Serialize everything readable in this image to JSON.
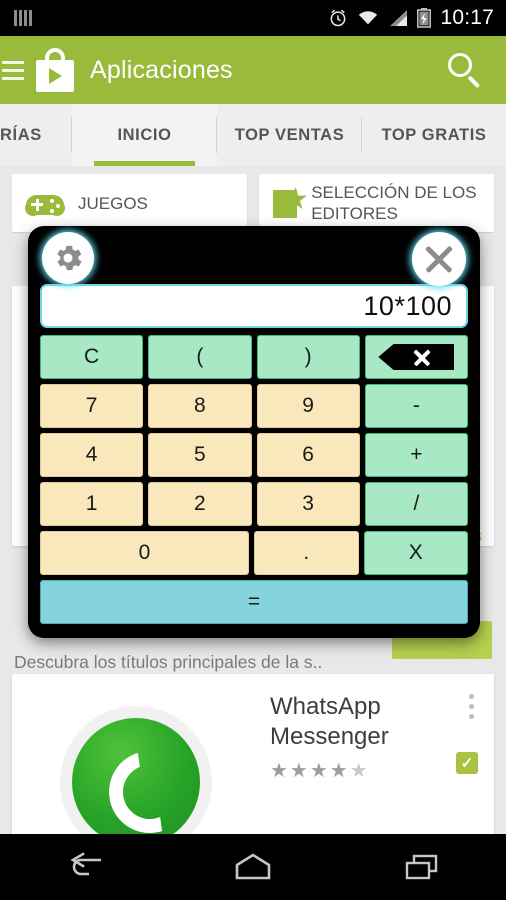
{
  "status_bar": {
    "clock": "10:17",
    "icons": [
      "sim-signal-bars-icon",
      "alarm-icon",
      "wifi-icon",
      "cell-signal-icon",
      "battery-charging-icon"
    ]
  },
  "action_bar": {
    "menu_icon": "hamburger-menu-icon",
    "logo_icon": "google-play-bag-icon",
    "title": "Aplicaciones",
    "search_icon": "search-icon",
    "bg_color": "#9aba3c"
  },
  "tabs": [
    {
      "label": "RÍAS",
      "active": false
    },
    {
      "label": "INICIO",
      "active": true
    },
    {
      "label": "TOP VENTAS",
      "active": false
    },
    {
      "label": "TOP GRATIS",
      "active": false
    }
  ],
  "content": {
    "categories": [
      {
        "label": "JUEGOS",
        "icon": "gamepad-icon"
      },
      {
        "label": "SELECCIÓN DE LOS EDITORES",
        "icon": "editors-choice-star-icon"
      }
    ],
    "blurb": "Descubra los títulos principales de la s..",
    "ghost_text_s": "s",
    "app_card": {
      "title": "WhatsApp Messenger",
      "icon": "whatsapp-phone-icon",
      "rating_filled": 4,
      "rating_total": 5,
      "overflow_icon": "more-vertical-icon",
      "installed_icon": "installed-check-badge-icon",
      "installed_glyph": "✓"
    }
  },
  "calculator": {
    "settings_icon": "gear-icon",
    "close_icon": "close-icon",
    "display_value": "10*100",
    "rows": [
      [
        {
          "label": "C",
          "type": "op",
          "name": "clear-key"
        },
        {
          "label": "(",
          "type": "op",
          "name": "open-paren-key"
        },
        {
          "label": ")",
          "type": "op",
          "name": "close-paren-key"
        },
        {
          "label": "",
          "type": "op",
          "name": "backspace-key",
          "icon": "backspace-icon"
        }
      ],
      [
        {
          "label": "7",
          "type": "num",
          "name": "digit-7-key"
        },
        {
          "label": "8",
          "type": "num",
          "name": "digit-8-key"
        },
        {
          "label": "9",
          "type": "num",
          "name": "digit-9-key"
        },
        {
          "label": "-",
          "type": "op",
          "name": "minus-key"
        }
      ],
      [
        {
          "label": "4",
          "type": "num",
          "name": "digit-4-key"
        },
        {
          "label": "5",
          "type": "num",
          "name": "digit-5-key"
        },
        {
          "label": "6",
          "type": "num",
          "name": "digit-6-key"
        },
        {
          "label": "+",
          "type": "op",
          "name": "plus-key"
        }
      ],
      [
        {
          "label": "1",
          "type": "num",
          "name": "digit-1-key"
        },
        {
          "label": "2",
          "type": "num",
          "name": "digit-2-key"
        },
        {
          "label": "3",
          "type": "num",
          "name": "digit-3-key"
        },
        {
          "label": "/",
          "type": "op",
          "name": "divide-key"
        }
      ],
      [
        {
          "label": "0",
          "type": "num",
          "name": "digit-0-key",
          "wide": true
        },
        {
          "label": ".",
          "type": "num",
          "name": "decimal-point-key"
        },
        {
          "label": "X",
          "type": "op",
          "name": "multiply-key"
        }
      ]
    ],
    "equals": {
      "label": "=",
      "name": "equals-key"
    },
    "colors": {
      "number_key": "#f8e8bc",
      "operator_key": "#a8e8c4",
      "equals_key": "#85d3dc",
      "panel": "#000000",
      "display_border": "#6fd2e8"
    }
  },
  "nav_bar": {
    "back_icon": "back-arrow-icon",
    "home_icon": "home-icon",
    "recents_icon": "recent-apps-icon"
  }
}
